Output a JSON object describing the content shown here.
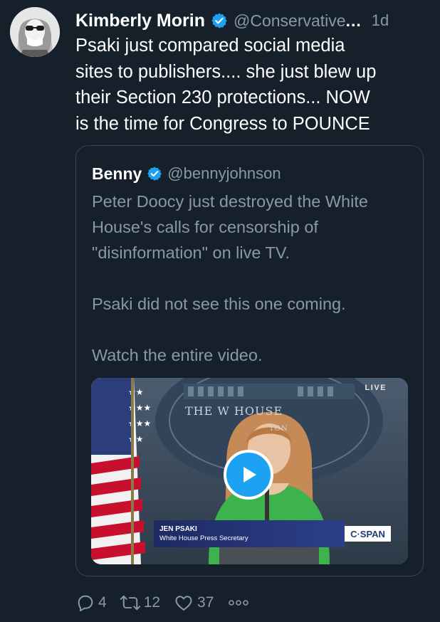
{
  "author": {
    "name": "Kimberly Morin",
    "handle": "@Conservative",
    "handle_more": "...",
    "time": "1d"
  },
  "tweet": {
    "lines": [
      "Psaki just compared social media",
      "sites to publishers.... she just blew up",
      "their Section 230 protections... NOW",
      "is the time for Congress to POUNCE"
    ]
  },
  "quoted": {
    "name": "Benny",
    "handle": "@bennyjohnson",
    "paragraphs": [
      [
        "Peter Doocy just destroyed the White",
        "House's calls for censorship of",
        "\"disinformation\" on live TV."
      ],
      [
        "Psaki did not see this one coming."
      ],
      [
        "Watch the entire video."
      ]
    ],
    "video": {
      "live_label": "LIVE",
      "backdrop_text": "THE W  HOUSE",
      "backdrop_sub": "TON",
      "lower_third_name": "JEN PSAKI",
      "lower_third_title": "White House Press Secretary",
      "network": "C·SPAN"
    }
  },
  "actions": {
    "replies": "4",
    "retweets": "12",
    "likes": "37"
  },
  "colors": {
    "background": "#15202b",
    "secondary_text": "#8899a6",
    "accent": "#1da1f2",
    "border": "#38444d"
  },
  "icons": [
    "verified-icon",
    "reply-icon",
    "retweet-icon",
    "like-icon",
    "more-icon",
    "play-icon"
  ]
}
